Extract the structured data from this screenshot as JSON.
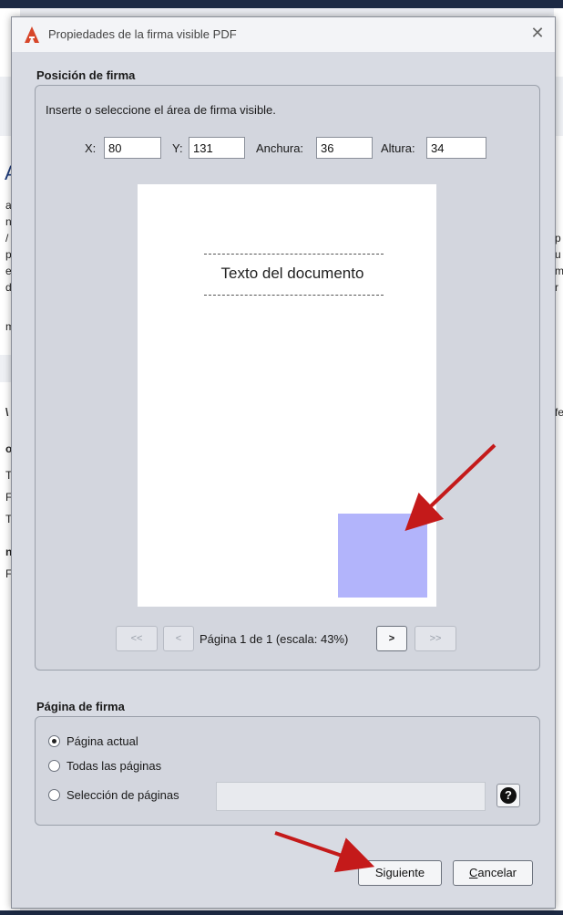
{
  "window": {
    "title": "Propiedades de la firma visible PDF"
  },
  "position_section": {
    "label": "Posición de firma",
    "instruction": "Inserte o seleccione el área de firma visible.",
    "fields": {
      "x_label": "X:",
      "x_value": "80",
      "y_label": "Y:",
      "y_value": "131",
      "width_label": "Anchura:",
      "width_value": "36",
      "height_label": "Altura:",
      "height_value": "34"
    },
    "preview": {
      "document_text": "Texto del documento"
    },
    "navigation": {
      "first": "<<",
      "prev": "<",
      "page_info": "Página 1 de 1 (escala: 43%)",
      "next": ">",
      "last": ">>"
    }
  },
  "signature_page_section": {
    "label": "Página de firma",
    "options": [
      {
        "label": "Página actual",
        "selected": true
      },
      {
        "label": "Todas las páginas",
        "selected": false
      },
      {
        "label": "Selección de páginas",
        "selected": false
      }
    ],
    "pages_value": ""
  },
  "buttons": {
    "next": "Siguiente",
    "cancel": "Cancelar"
  },
  "colors": {
    "signature_area": "#b2b4fb",
    "arrow": "#c41a1a",
    "accent_icon": "#d7462a"
  },
  "icons": [
    "app-icon",
    "close-icon",
    "help-icon",
    "arrow-annotation"
  ],
  "background": {
    "left_fragments": [
      "A",
      "ar",
      "n",
      "/",
      "p",
      "er",
      "d",
      "m",
      "\\",
      "o",
      "Ti",
      "Fe",
      "Ta",
      "n",
      "Fc"
    ],
    "right_fragments": [
      "p",
      "u",
      "m",
      "r",
      "fe"
    ]
  }
}
